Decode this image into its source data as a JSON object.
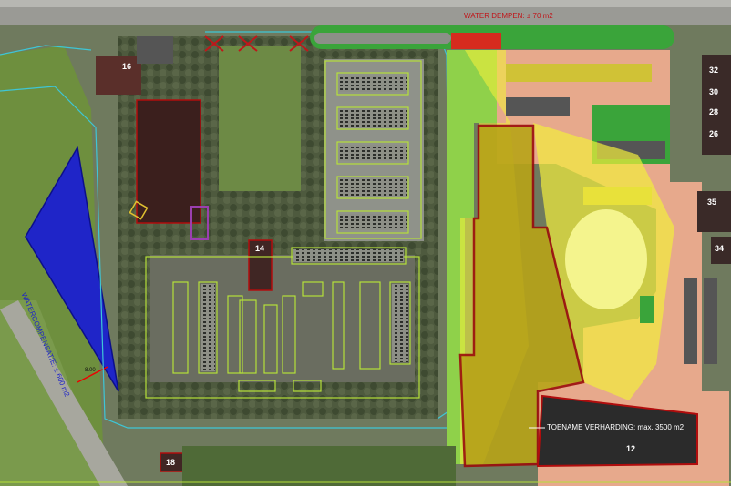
{
  "annotations": {
    "water_dampen": "WATER DEMPEN: ± 70 m2",
    "water_compensation": "WATERCOMPENSATIE: ± 600 m2",
    "paving_increase": "TOENAME VERHARDING: max. 3500 m2",
    "dim_small": "8.00"
  },
  "building_numbers": {
    "b16": "16",
    "b14": "14",
    "b12": "12",
    "b18": "18",
    "b32": "32",
    "b30": "30",
    "b28": "28",
    "b26": "26",
    "b35": "35",
    "b34": "34"
  },
  "colors": {
    "water_compensation_area": "#1f25c8",
    "development_zone": "#d8c21a",
    "highlight_yellow": "#f2ee3c",
    "red_outline": "#b10d0d",
    "lime_lines": "#b5e03a",
    "paving_pink": "#e7a98c",
    "green_fields": "#3aa43a"
  }
}
